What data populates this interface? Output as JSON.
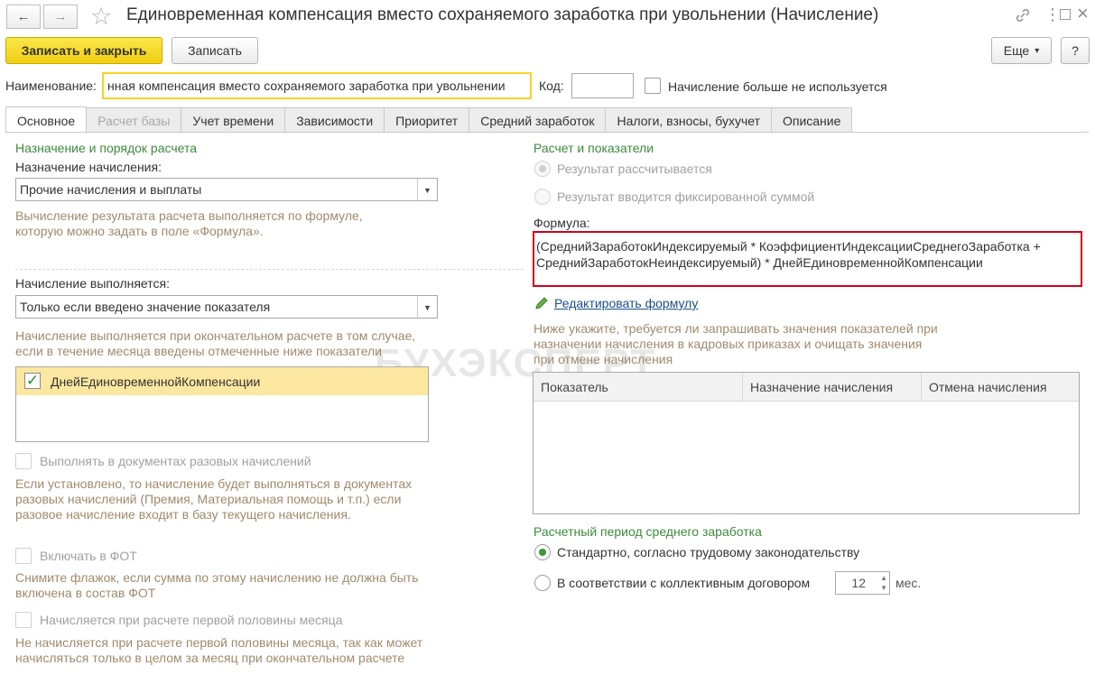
{
  "window": {
    "title": "Единовременная компенсация вместо сохраняемого заработка при увольнении (Начисление)",
    "back_icon": "←",
    "forward_icon": "→",
    "star_icon": "☆",
    "link_icon": "🔗",
    "menu_icon": "⋮",
    "maximize_icon": "□",
    "close_icon": "×"
  },
  "toolbar": {
    "save_close_label": "Записать и закрыть",
    "save_label": "Записать",
    "more_label": "Еще",
    "more_arrow": "▾",
    "help_label": "?"
  },
  "header": {
    "name_label": "Наименование:",
    "name_value": "нная компенсация вместо сохраняемого заработка при увольнении",
    "code_label": "Код:",
    "code_value": "",
    "not_used_label": "Начисление больше не используется"
  },
  "tabs": [
    {
      "label": "Основное"
    },
    {
      "label": "Расчет базы"
    },
    {
      "label": "Учет времени"
    },
    {
      "label": "Зависимости"
    },
    {
      "label": "Приоритет"
    },
    {
      "label": "Средний заработок"
    },
    {
      "label": "Налоги, взносы, бухучет"
    },
    {
      "label": "Описание"
    }
  ],
  "left": {
    "section_title": "Назначение и порядок расчета",
    "purpose_label": "Назначение начисления:",
    "purpose_value": "Прочие начисления и выплаты",
    "purpose_hint": "Вычисление результата расчета выполняется по формуле, которую можно задать в поле «Формула».",
    "exec_label": "Начисление выполняется:",
    "exec_value": "Только если введено значение показателя",
    "exec_hint": "Начисление выполняется при окончательном расчете в том случае, если в течение месяца введены отмеченные ниже показатели",
    "indicator_item": "ДнейЕдиновременнойКомпенсации",
    "check_mark": "✓",
    "one_time_label": "Выполнять в документах разовых начислений",
    "one_time_hint": "Если установлено, то начисление будет выполняться в документах разовых начислений (Премия, Материальная помощь и т.п.) если разовое начисление входит в базу текущего начисления.",
    "fot_label": "Включать в ФОТ",
    "fot_hint": "Снимите флажок, если сумма по этому начислению не должна быть включена в состав ФОТ",
    "first_half_label": "Начисляется при расчете первой половины месяца",
    "first_half_hint": "Не начисляется при расчете первой половины месяца, так как может начисляться только в целом за месяц при окончательном расчете"
  },
  "right": {
    "section_title": "Расчет и показатели",
    "radio_calc": "Результат рассчитывается",
    "radio_fixed": "Результат вводится фиксированной суммой",
    "formula_label": "Формула:",
    "formula_value": "(СреднийЗаработокИндексируемый * КоэффициентИндексацииСреднегоЗаработка + СреднийЗаработокНеиндексируемый) * ДнейЕдиновременнойКомпенсации",
    "edit_formula_link": "Редактировать формулу",
    "indicators_hint": "Ниже укажите, требуется ли запрашивать значения показателей при назначении начисления в кадровых приказах и очищать значения при отмене начисления",
    "table_headers": [
      "Показатель",
      "Назначение начисления",
      "Отмена начисления"
    ],
    "period_title": "Расчетный период среднего заработка",
    "period_standard": "Стандартно, согласно трудовому законодательству",
    "period_collective": "В соответствии с коллективным договором",
    "months_value": "12",
    "months_unit": "мес."
  },
  "watermark": "БУХЭКСПЕРТ",
  "colors": {
    "accent_yellow": "#f5d423",
    "section_green": "#3d8a3d",
    "hint_brown": "#a08a6b",
    "formula_border": "#d0021b",
    "link_blue": "#1a4f8a"
  }
}
